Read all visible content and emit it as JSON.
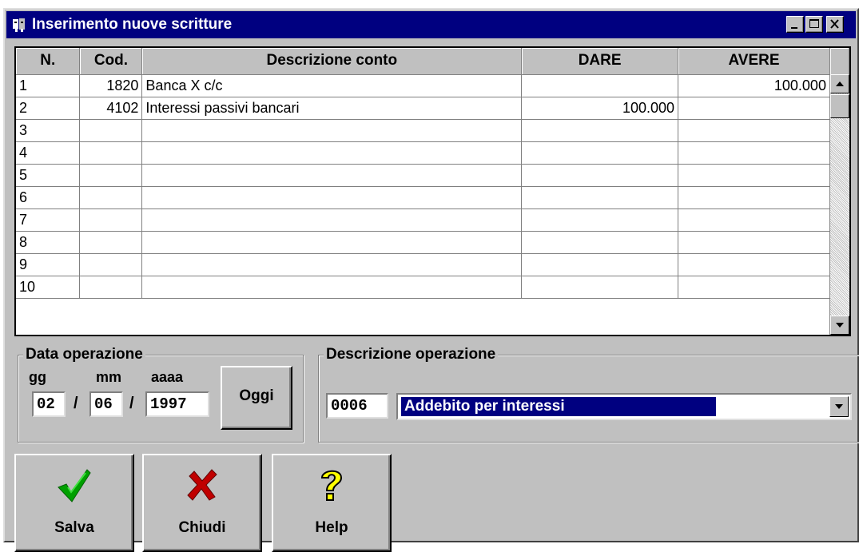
{
  "window": {
    "title": "Inserimento nuove scritture"
  },
  "grid": {
    "headers": [
      "N.",
      "Cod.",
      "Descrizione conto",
      "DARE",
      "AVERE"
    ],
    "rows": [
      {
        "n": "1",
        "cod": "1820",
        "desc": "Banca X c/c",
        "dare": "",
        "avere": "100.000"
      },
      {
        "n": "2",
        "cod": "4102",
        "desc": "Interessi passivi bancari",
        "dare": "100.000",
        "avere": ""
      },
      {
        "n": "3",
        "cod": "",
        "desc": "",
        "dare": "",
        "avere": ""
      },
      {
        "n": "4",
        "cod": "",
        "desc": "",
        "dare": "",
        "avere": ""
      },
      {
        "n": "5",
        "cod": "",
        "desc": "",
        "dare": "",
        "avere": ""
      },
      {
        "n": "6",
        "cod": "",
        "desc": "",
        "dare": "",
        "avere": ""
      },
      {
        "n": "7",
        "cod": "",
        "desc": "",
        "dare": "",
        "avere": ""
      },
      {
        "n": "8",
        "cod": "",
        "desc": "",
        "dare": "",
        "avere": ""
      },
      {
        "n": "9",
        "cod": "",
        "desc": "",
        "dare": "",
        "avere": ""
      },
      {
        "n": "10",
        "cod": "",
        "desc": "",
        "dare": "",
        "avere": ""
      }
    ]
  },
  "data_operazione": {
    "title": "Data operazione",
    "gg_label": "gg",
    "mm_label": "mm",
    "aaaa_label": "aaaa",
    "gg": "02",
    "mm": "06",
    "aaaa": "1997",
    "slash": "/",
    "oggi_label": "Oggi"
  },
  "descrizione_operazione": {
    "title": "Descrizione operazione",
    "code": "0006",
    "selected": "Addebito per interessi"
  },
  "buttons": {
    "salva": "Salva",
    "chiudi": "Chiudi",
    "help": "Help"
  },
  "icons": {
    "salva": "checkmark-icon",
    "chiudi": "x-icon",
    "help": "question-mark-icon"
  },
  "colors": {
    "titlebar": "#000080",
    "selection": "#000080",
    "check": "#00a000",
    "cross": "#c00000",
    "help": "#ffff00"
  }
}
